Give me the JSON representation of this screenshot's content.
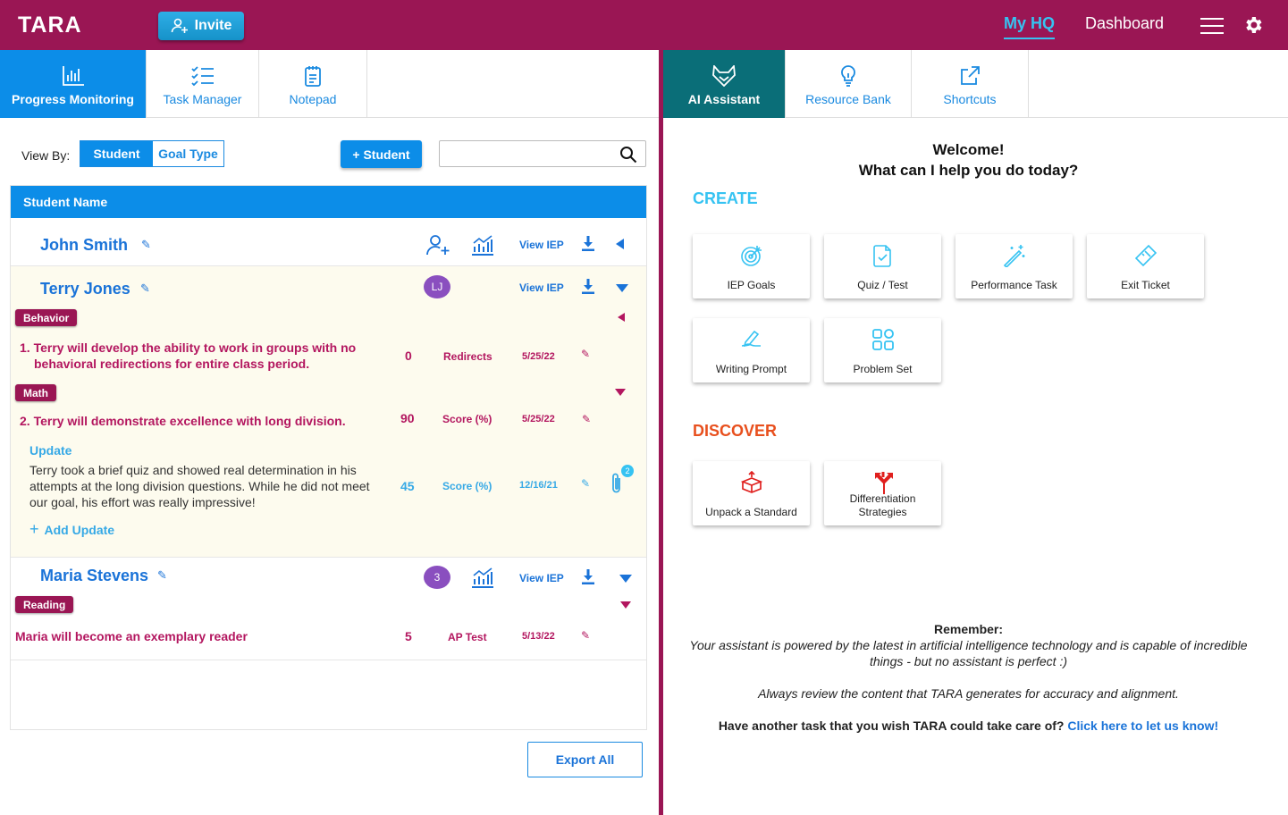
{
  "header": {
    "logo": "TARA",
    "invite_label": "Invite",
    "nav_myhq": "My HQ",
    "nav_dashboard": "Dashboard"
  },
  "left_tabs": [
    "Progress Monitoring",
    "Task Manager",
    "Notepad"
  ],
  "right_tabs": [
    "AI Assistant",
    "Resource Bank",
    "Shortcuts"
  ],
  "toolbar": {
    "view_by_label": "View By:",
    "toggle_student": "Student",
    "toggle_goal_type": "Goal Type",
    "add_student_label": "+ Student",
    "search_placeholder": ""
  },
  "table": {
    "header": "Student Name",
    "view_iep_label": "View IEP",
    "students": [
      {
        "name": "John Smith"
      },
      {
        "name": "Terry Jones",
        "avatar": "LJ",
        "goals": [
          {
            "tag": "Behavior",
            "text": "1. Terry will develop the ability to work in groups with no behavioral redirections for entire class period.",
            "value": "0",
            "measure": "Redirects",
            "date": "5/25/22"
          },
          {
            "tag": "Math",
            "text": "2. Terry will demonstrate excellence with long division.",
            "value": "90",
            "measure": "Score (%)",
            "date": "5/25/22"
          }
        ],
        "update": {
          "title": "Update",
          "text": "Terry took a brief quiz and showed real determination in his attempts at the long division questions.  While he did not meet our goal, his effort was really impressive!",
          "value": "45",
          "measure": "Score (%)",
          "date": "12/16/21",
          "attachments": "2"
        },
        "add_update_label": "Add Update"
      },
      {
        "name": "Maria Stevens",
        "avatar": "3",
        "goals": [
          {
            "tag": "Reading",
            "text": "Maria will become an exemplary reader",
            "value": "5",
            "measure": "AP Test",
            "date": "5/13/22"
          }
        ]
      }
    ]
  },
  "export_label": "Export All",
  "assistant": {
    "welcome_line1": "Welcome!",
    "welcome_line2": "What can I help you do today?",
    "create_heading": "CREATE",
    "create_cards": [
      "IEP Goals",
      "Quiz / Test",
      "Performance Task",
      "Exit Ticket",
      "Writing Prompt",
      "Problem Set"
    ],
    "discover_heading": "DISCOVER",
    "discover_cards": [
      "Unpack a Standard",
      "Differentiation Strategies"
    ],
    "remember_title": "Remember:",
    "remember_text": "Your assistant is powered by the latest in artificial intelligence technology and is capable of incredible things - but no assistant is perfect :)",
    "review_text": "Always review the content that TARA generates for accuracy and alignment.",
    "feedback_text": "Have another task that you wish TARA could take care of?",
    "feedback_link": "Click here to let us know!"
  },
  "colors": {
    "brand": "#9a1654",
    "primary_blue": "#0c8de8",
    "teal": "#0a6e78",
    "create_cyan": "#36c3f2",
    "discover_orange": "#e8501e",
    "row_highlight": "#fdfbee"
  },
  "icons": [
    "add-user-icon",
    "bar-chart-icon",
    "checklist-icon",
    "notepad-icon",
    "fox-icon",
    "lightbulb-icon",
    "external-link-icon",
    "search-icon",
    "gear-icon",
    "menu-icon",
    "download-icon",
    "pencil-icon",
    "paperclip-icon",
    "target-icon",
    "quiz-icon",
    "magic-wand-icon",
    "ticket-icon",
    "writing-hand-icon",
    "shapes-icon",
    "box-icon",
    "arrows-split-icon"
  ]
}
